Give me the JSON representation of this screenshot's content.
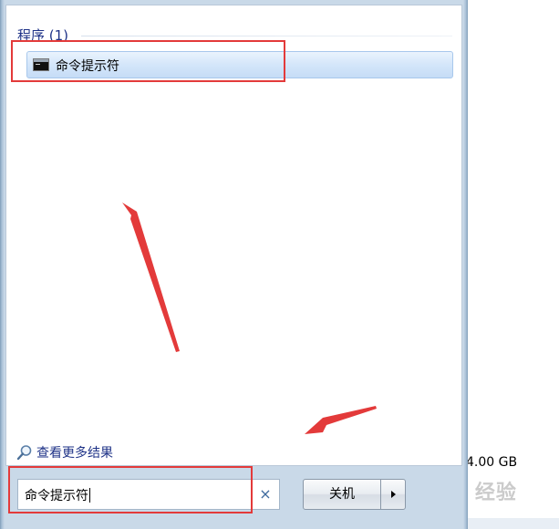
{
  "results": {
    "group_header": "程序 (1)",
    "items": [
      {
        "label": "命令提示符",
        "icon": "command-prompt-icon"
      }
    ],
    "more_results_label": "查看更多结果"
  },
  "search": {
    "value": "命令提示符",
    "clear_glyph": "×"
  },
  "power": {
    "shutdown_label": "关机"
  },
  "background": {
    "disk_text": "4.00 GB",
    "watermark": "Bai 经验"
  },
  "colors": {
    "annotation": "#e33a3a",
    "link_text": "#1e3287",
    "selection_fill": "#d4e6fa"
  }
}
